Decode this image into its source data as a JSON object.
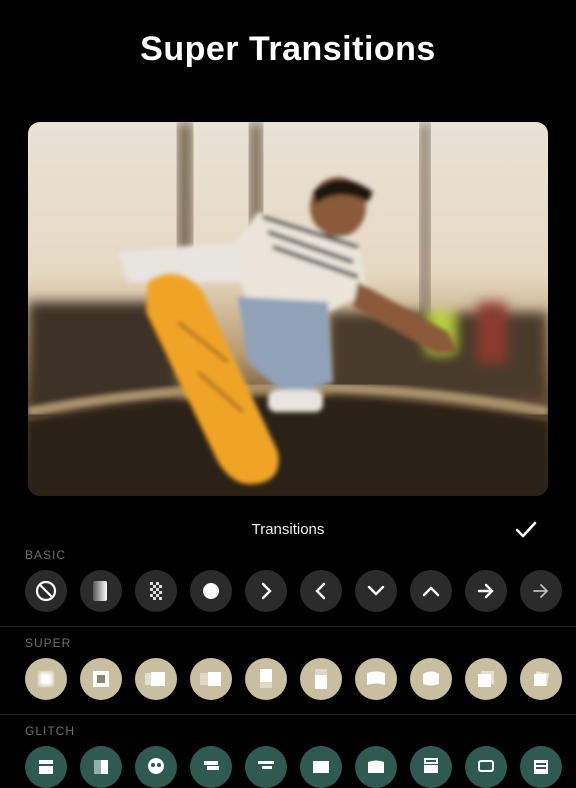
{
  "header": {
    "title": "Super Transitions"
  },
  "panel": {
    "title": "Transitions",
    "done_icon": "checkmark-icon"
  },
  "sections": [
    {
      "label": "BASIC",
      "items": [
        "none-icon",
        "fade-icon",
        "dissolve-icon",
        "circle-icon",
        "chevron-right-icon",
        "chevron-left-icon",
        "chevron-down-icon",
        "chevron-up-icon",
        "arrow-right-icon",
        "arrow-right-thin-icon"
      ]
    },
    {
      "label": "SUPER",
      "items": [
        "zoom-blur-icon",
        "zoom-frame-icon",
        "slide-blur-icon",
        "motion-blur-icon",
        "push-up-icon",
        "push-down-icon",
        "warp-icon",
        "bend-icon",
        "spin-icon",
        "rotate-icon"
      ]
    },
    {
      "label": "GLITCH",
      "items": [
        "glitch-film-icon",
        "glitch-split-icon",
        "glitch-skull-icon",
        "glitch-shift-icon",
        "glitch-slice-icon",
        "glitch-stretch-icon",
        "glitch-wave-icon",
        "glitch-tv-icon",
        "glitch-monitor-icon",
        "glitch-scan-icon"
      ]
    }
  ],
  "colors": {
    "accent": "#ffffff",
    "basic_chip": "#2b2b2b",
    "super_chip": "#c8bfa1",
    "glitch_chip": "#2e5a52"
  }
}
